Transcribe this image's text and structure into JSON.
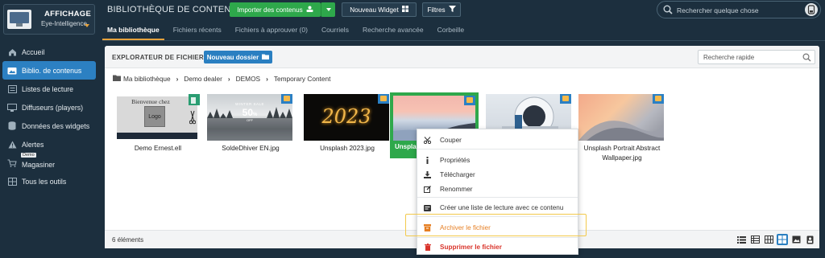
{
  "brand": {
    "title": "AFFICHAGE",
    "subtitle": "Eye-Intelligence"
  },
  "sidebar": {
    "items": [
      {
        "label": "Accueil",
        "icon": "home-icon"
      },
      {
        "label": "Biblio. de contenus",
        "icon": "folder-image-icon",
        "active": true
      },
      {
        "label": "Listes de lecture",
        "icon": "list-icon"
      },
      {
        "label": "Diffuseurs (players)",
        "icon": "monitor-icon"
      },
      {
        "label": "Données des widgets",
        "icon": "database-icon"
      },
      {
        "label": "Alertes",
        "icon": "warning-icon"
      },
      {
        "label": "Magasiner",
        "icon": "cart-icon",
        "badge": "Demo"
      },
      {
        "label": "Tous les outils",
        "icon": "tools-icon"
      }
    ]
  },
  "header": {
    "title": "BIBLIOTHÈQUE DE CONTENUS",
    "import_label": "Importer des contenus",
    "new_widget_label": "Nouveau Widget",
    "filters_label": "Filtres",
    "search_placeholder": "Rechercher quelque chose"
  },
  "tabs": [
    {
      "label": "Ma bibliothèque",
      "active": true
    },
    {
      "label": "Fichiers récents"
    },
    {
      "label": "Fichiers à approuver (0)"
    },
    {
      "label": "Courriels"
    },
    {
      "label": "Recherche avancée"
    },
    {
      "label": "Corbeille"
    }
  ],
  "explorer": {
    "title": "EXPLORATEUR DE FICHIERS",
    "new_folder_label": "Nouveau dossier",
    "quick_search_placeholder": "Recherche rapide",
    "breadcrumb": [
      "Ma bibliothèque",
      "Demo dealer",
      "DEMOS",
      "Temporary Content"
    ],
    "files": [
      {
        "name": "Demo Ernest.ell",
        "thumb": "widget",
        "widget_text": "Bienvenue chez",
        "logo_text": "Logo"
      },
      {
        "name": "SoldeDhiver EN.jpg",
        "thumb": "sale",
        "sale_title": "WINTER SALE",
        "sale_value": "50",
        "sale_unit": "%",
        "sale_off": "OFF"
      },
      {
        "name": "Unsplash 2023.jpg",
        "thumb": "year",
        "year_text": "2023"
      },
      {
        "name": "Unsplash...",
        "thumb": "beach",
        "selected": true
      },
      {
        "name": "",
        "thumb": "medical"
      },
      {
        "name": "Unsplash Portrait Abstract Wallpaper.jpg",
        "thumb": "abstract"
      }
    ],
    "count_label": "6 éléments"
  },
  "context_menu": {
    "items": [
      {
        "label": "Couper",
        "icon": "scissors-icon"
      },
      {
        "label": "Propriétés",
        "icon": "info-icon"
      },
      {
        "label": "Télécharger",
        "icon": "download-icon"
      },
      {
        "label": "Renommer",
        "icon": "edit-icon"
      },
      {
        "label": "Créer une liste de lecture avec ce contenu",
        "icon": "playlist-icon"
      },
      {
        "label": "Archiver le fichier",
        "icon": "archive-icon",
        "color": "#e67e22"
      },
      {
        "label": "Supprimer le fichier",
        "icon": "trash-icon",
        "color": "#d9342b"
      }
    ]
  },
  "colors": {
    "background": "#1c2f3e",
    "accent_blue": "#2a7fc1",
    "import_green": "#2ea84b",
    "tab_underline": "#e6a23c",
    "highlight": "#f2c94c"
  }
}
